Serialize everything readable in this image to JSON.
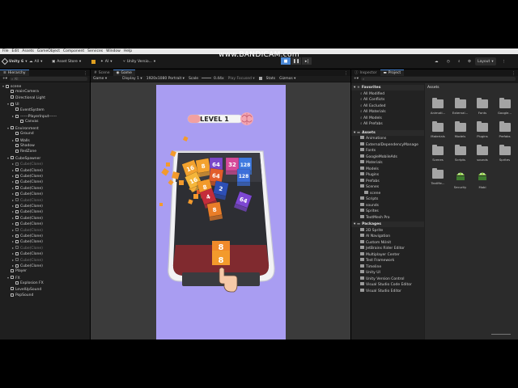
{
  "watermark": "www.BANDICAM.com",
  "menu": [
    "File",
    "Edit",
    "Assets",
    "GameObject",
    "Component",
    "Services",
    "Window",
    "Help"
  ],
  "toolbar": {
    "app": "Unity 6",
    "all": "All",
    "asset_store": "Asset Store",
    "ai": "AI",
    "version_control": "Unity Versio...",
    "layout": "Layout"
  },
  "hierarchy": {
    "tab": "Hierarchy",
    "search_placeholder": "All",
    "rows": [
      {
        "label": "scene",
        "depth": 0,
        "arrow": "▾",
        "dim": false
      },
      {
        "label": "mainCamera",
        "depth": 1,
        "arrow": "",
        "dim": false
      },
      {
        "label": "Directional Light",
        "depth": 1,
        "arrow": "",
        "dim": false
      },
      {
        "label": "UI",
        "depth": 1,
        "arrow": "▾",
        "dim": false
      },
      {
        "label": "EventSystem",
        "depth": 2,
        "arrow": "",
        "dim": false
      },
      {
        "label": "------PlayerInput------",
        "depth": 2,
        "arrow": "▸",
        "dim": false
      },
      {
        "label": "Canvas",
        "depth": 3,
        "arrow": "",
        "dim": false
      },
      {
        "label": "Environment",
        "depth": 1,
        "arrow": "▾",
        "dim": false
      },
      {
        "label": "Ground",
        "depth": 2,
        "arrow": "",
        "dim": false
      },
      {
        "label": "Walls",
        "depth": 2,
        "arrow": "▸",
        "dim": false
      },
      {
        "label": "Shadow",
        "depth": 2,
        "arrow": "",
        "dim": false
      },
      {
        "label": "RedZone",
        "depth": 2,
        "arrow": "",
        "dim": false
      },
      {
        "label": "CubeSpawner",
        "depth": 1,
        "arrow": "▾",
        "dim": false
      },
      {
        "label": "Cube(Clone)",
        "depth": 2,
        "arrow": "▸",
        "dim": true
      },
      {
        "label": "Cube(Clone)",
        "depth": 2,
        "arrow": "▸",
        "dim": false
      },
      {
        "label": "Cube(Clone)",
        "depth": 2,
        "arrow": "▸",
        "dim": false
      },
      {
        "label": "Cube(Clone)",
        "depth": 2,
        "arrow": "▸",
        "dim": false
      },
      {
        "label": "Cube(Clone)",
        "depth": 2,
        "arrow": "▸",
        "dim": false
      },
      {
        "label": "Cube(Clone)",
        "depth": 2,
        "arrow": "▸",
        "dim": false
      },
      {
        "label": "Cube(Clone)",
        "depth": 2,
        "arrow": "▸",
        "dim": true
      },
      {
        "label": "Cube(Clone)",
        "depth": 2,
        "arrow": "▸",
        "dim": false
      },
      {
        "label": "Cube(Clone)",
        "depth": 2,
        "arrow": "▸",
        "dim": false
      },
      {
        "label": "Cube(Clone)",
        "depth": 2,
        "arrow": "▸",
        "dim": false
      },
      {
        "label": "Cube(Clone)",
        "depth": 2,
        "arrow": "▸",
        "dim": false
      },
      {
        "label": "Cube(Clone)",
        "depth": 2,
        "arrow": "▸",
        "dim": true
      },
      {
        "label": "Cube(Clone)",
        "depth": 2,
        "arrow": "▸",
        "dim": false
      },
      {
        "label": "Cube(Clone)",
        "depth": 2,
        "arrow": "▸",
        "dim": false
      },
      {
        "label": "Cube(Clone)",
        "depth": 2,
        "arrow": "▸",
        "dim": true
      },
      {
        "label": "Cube(Clone)",
        "depth": 2,
        "arrow": "▸",
        "dim": false
      },
      {
        "label": "Cube(Clone)",
        "depth": 2,
        "arrow": "▸",
        "dim": true
      },
      {
        "label": "Cube(Clone)",
        "depth": 2,
        "arrow": "▸",
        "dim": false
      },
      {
        "label": "Player",
        "depth": 1,
        "arrow": "",
        "dim": false
      },
      {
        "label": "FX",
        "depth": 1,
        "arrow": "▾",
        "dim": false
      },
      {
        "label": "Explosion FX",
        "depth": 2,
        "arrow": "",
        "dim": false
      },
      {
        "label": "LevelUpSound",
        "depth": 1,
        "arrow": "",
        "dim": false
      },
      {
        "label": "PopSound",
        "depth": 1,
        "arrow": "",
        "dim": false
      }
    ]
  },
  "scene_tabs": {
    "scene": "Scene",
    "game": "Game"
  },
  "game_bar": {
    "game": "Game",
    "display": "Display 1",
    "resolution": "1920x1080 Portrait",
    "scale_label": "Scale",
    "scale_value": "0.44x",
    "play_focused": "Play Focused",
    "stats": "Stats",
    "gizmos": "Gizmos"
  },
  "game": {
    "level": "LEVEL 1",
    "next_cube": "8",
    "cubes": [
      {
        "n": "16",
        "c": "#f3a22f"
      },
      {
        "n": "8",
        "c": "#f3a22f"
      },
      {
        "n": "64",
        "c": "#7b47c9"
      },
      {
        "n": "32",
        "c": "#d54a9a"
      },
      {
        "n": "128",
        "c": "#3f7ae0"
      },
      {
        "n": "16",
        "c": "#f5b63a"
      },
      {
        "n": "64",
        "c": "#e25d2b"
      },
      {
        "n": "128",
        "c": "#3d6fd9"
      },
      {
        "n": "8",
        "c": "#f29a2a"
      },
      {
        "n": "2",
        "c": "#2d4fb5"
      },
      {
        "n": "4",
        "c": "#c42d3b"
      },
      {
        "n": "64",
        "c": "#7d47d2"
      },
      {
        "n": "8",
        "c": "#e97d28"
      }
    ]
  },
  "inspector": {
    "tab_inspector": "Inspector",
    "tab_project": "Project"
  },
  "favorites": {
    "title": "Favorites",
    "items": [
      "All Modified",
      "All Conflicts",
      "All Excluded",
      "All Materials",
      "All Models",
      "All Prefabs"
    ]
  },
  "assets_tree": {
    "title": "Assets",
    "items": [
      {
        "label": "Animations",
        "depth": 1
      },
      {
        "label": "ExternalDependencyManage",
        "depth": 1
      },
      {
        "label": "Fonts",
        "depth": 1
      },
      {
        "label": "GoogleMobileAds",
        "depth": 1
      },
      {
        "label": "Materials",
        "depth": 1
      },
      {
        "label": "Models",
        "depth": 1
      },
      {
        "label": "Plugins",
        "depth": 1
      },
      {
        "label": "Prefabs",
        "depth": 1
      },
      {
        "label": "Scenes",
        "depth": 1
      },
      {
        "label": "scene",
        "depth": 2
      },
      {
        "label": "Scripts",
        "depth": 1
      },
      {
        "label": "sounds",
        "depth": 1
      },
      {
        "label": "Sprites",
        "depth": 1
      },
      {
        "label": "TextMesh Pro",
        "depth": 1
      }
    ]
  },
  "packages_tree": {
    "title": "Packages",
    "items": [
      "2D Sprite",
      "AI Navigation",
      "Custom NUnit",
      "JetBrains Rider Editor",
      "Multiplayer Center",
      "Test Framework",
      "Timeline",
      "Unity UI",
      "Unity Version Control",
      "Visual Studio Code Editor",
      "Visual Studio Editor"
    ]
  },
  "assets_grid": {
    "title": "Assets",
    "items": [
      {
        "label": "Animati...",
        "kind": "folder"
      },
      {
        "label": "External...",
        "kind": "folder"
      },
      {
        "label": "Fonts",
        "kind": "folder"
      },
      {
        "label": "Google...",
        "kind": "folder"
      },
      {
        "label": "Materials",
        "kind": "folder"
      },
      {
        "label": "Models",
        "kind": "folder"
      },
      {
        "label": "Plugins",
        "kind": "folder"
      },
      {
        "label": "Prefabs",
        "kind": "folder"
      },
      {
        "label": "Scenes",
        "kind": "folder"
      },
      {
        "label": "Scripts",
        "kind": "folder"
      },
      {
        "label": "sounds",
        "kind": "folder"
      },
      {
        "label": "Sprites",
        "kind": "folder"
      },
      {
        "label": "TextMe...",
        "kind": "folder"
      },
      {
        "label": "Security",
        "kind": "android"
      },
      {
        "label": "Mobi",
        "kind": "android"
      }
    ]
  }
}
